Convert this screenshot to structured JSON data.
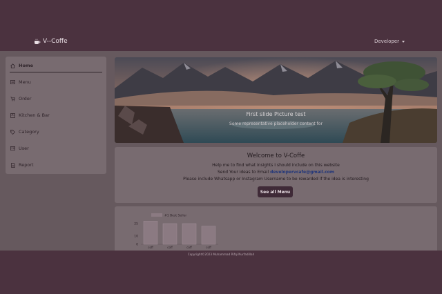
{
  "header": {
    "brand": "V--Coffe",
    "user_menu": "Developer"
  },
  "sidebar": {
    "items": [
      {
        "label": "Home",
        "icon": "home-icon",
        "active": true
      },
      {
        "label": "Menu",
        "icon": "menu-list-icon"
      },
      {
        "label": "Order",
        "icon": "cart-icon"
      },
      {
        "label": "Kitchen & Bar",
        "icon": "kitchen-icon"
      },
      {
        "label": "Category",
        "icon": "tag-icon"
      },
      {
        "label": "User",
        "icon": "user-card-icon"
      },
      {
        "label": "Report",
        "icon": "report-icon"
      }
    ]
  },
  "carousel": {
    "title": "First slide Picture test",
    "text": "Some representative placeholder content for"
  },
  "welcome": {
    "title": "Welcome to V-Coffe",
    "line1": "Help me to find what insights I should include on this website",
    "line2_prefix": "Send Your ideas to Email ",
    "email": "developervcafe@gmail.com",
    "line3": "Please include Whatsapp or Instagram Username to be rewarded if the idea is interesting",
    "button": "See all Menu"
  },
  "chart_data": {
    "type": "bar",
    "legend": "#1 Best Seller",
    "categories": [
      "coff",
      "coff",
      "coff",
      "coff"
    ],
    "values": [
      28,
      25,
      25,
      22
    ],
    "yticks": [
      "25",
      "10",
      "0"
    ],
    "ylim": [
      0,
      30
    ],
    "colors": {
      "bar": "#8b7a82",
      "legend_swatch": "#8b7a82"
    }
  },
  "footer": {
    "copyright": "Copyright©2023 Muhammad Rifqi Nurfadillah"
  },
  "colors": {
    "nav": "#4b323f",
    "content": "#66595e",
    "card": "#786b70",
    "button": "#3f2a37",
    "link": "#23377a"
  }
}
